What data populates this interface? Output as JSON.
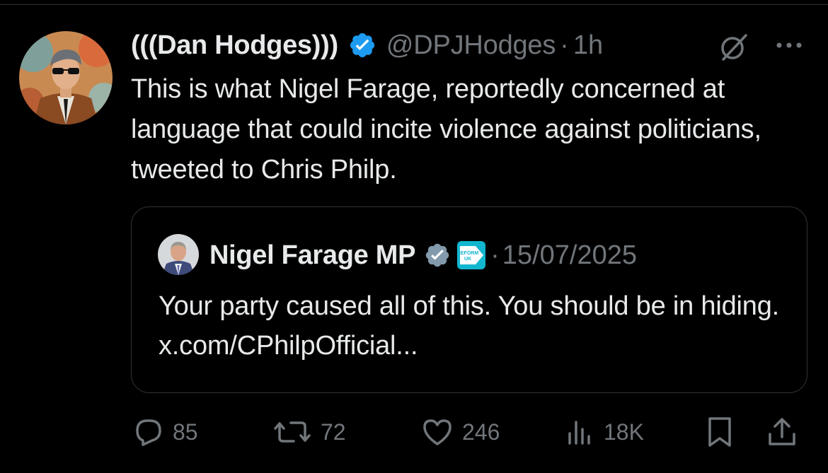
{
  "tweet": {
    "author": {
      "display_name": "(((Dan Hodges)))",
      "handle": "@DPJHodges",
      "separator": "·",
      "time": "1h",
      "verified": true
    },
    "text": "This is what Nigel Farage, reportedly concerned at language that could incite violence against politicians, tweeted to Chris Philp.",
    "quoted": {
      "display_name": "Nigel Farage MP",
      "verified": true,
      "party_badge_label": "REFORM UK",
      "separator": "·",
      "date": "15/07/2025",
      "text": "Your party caused all of this. You should be in hiding. x.com/CPhilpOfficial..."
    },
    "stats": {
      "replies": "85",
      "reposts": "72",
      "likes": "246",
      "views": "18K"
    }
  },
  "colors": {
    "background": "#000000",
    "text_primary": "#e7e9ea",
    "text_secondary": "#71767b",
    "border": "#2f3336",
    "verified_blue": "#1d9bf0",
    "verified_gray": "#829aab"
  },
  "icons": [
    "grok-icon",
    "more-icon",
    "reply-icon",
    "repost-icon",
    "like-icon",
    "views-icon",
    "bookmark-icon",
    "share-icon"
  ]
}
